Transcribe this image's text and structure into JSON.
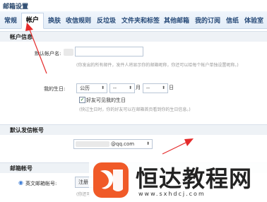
{
  "header": {
    "title": "邮箱设置"
  },
  "tabs": [
    {
      "label": "常规"
    },
    {
      "label": "帐户"
    },
    {
      "label": "换肤"
    },
    {
      "label": "收信规则"
    },
    {
      "label": "反垃圾"
    },
    {
      "label": "文件夹和标签"
    },
    {
      "label": "其他邮箱"
    },
    {
      "label": "我的订阅"
    },
    {
      "label": "信纸"
    },
    {
      "label": "体验室"
    }
  ],
  "account_info": {
    "section_title": "帐户信息",
    "default_name_label": "默认帐户名:",
    "default_name_value": "",
    "default_name_hint": "(你发出的所有邮件，发件人将显示你的邮箱昵称，你还可以给每个帐户单独设置昵称。)",
    "birthday_label": "我的生日:",
    "calendar_value": "公历",
    "month_value": "--",
    "month_suffix": "月",
    "day_value": "--",
    "day_suffix": "日",
    "friends_visible_label": "好友可见我的生日",
    "friends_visible_checked": true,
    "birthday_hint": "(快过生日时，你的好友可以在邮箱首页看到你的生日信息。)"
  },
  "default_sender": {
    "section_title": "默认发信帐号",
    "account_value": "@qq.com"
  },
  "mailbox_account": {
    "section_title": "邮箱帐号",
    "english_account_label": "英文邮箱帐号:",
    "register_button": "注册",
    "hint": "(你还可"
  },
  "watermark": {
    "text": "恒达教程网",
    "url": "www.sxhdcj.com",
    "logo_color": "#f05a28"
  }
}
